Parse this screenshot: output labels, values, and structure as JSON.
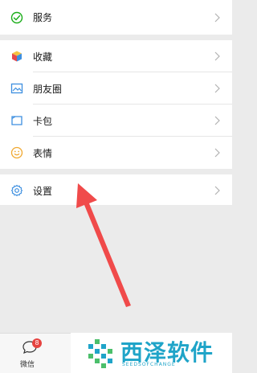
{
  "menu": {
    "service": {
      "label": "服务",
      "icon": "check-circle-icon"
    },
    "favorites": {
      "label": "收藏",
      "icon": "cube-icon"
    },
    "moments": {
      "label": "朋友圈",
      "icon": "photo-icon"
    },
    "cards": {
      "label": "卡包",
      "icon": "card-icon"
    },
    "stickers": {
      "label": "表情",
      "icon": "smiley-icon"
    },
    "settings": {
      "label": "设置",
      "icon": "gear-icon"
    }
  },
  "tabbar": {
    "chats": {
      "label": "微信",
      "badge": "8"
    }
  },
  "watermark": {
    "title": "西泽软件",
    "subtitle": "SEEDSOFCHANGE"
  },
  "colors": {
    "accent_green": "#1aad19",
    "badge_red": "#e64340",
    "arrow_red": "#f04a4a",
    "watermark_blue": "#1fa4c8"
  }
}
